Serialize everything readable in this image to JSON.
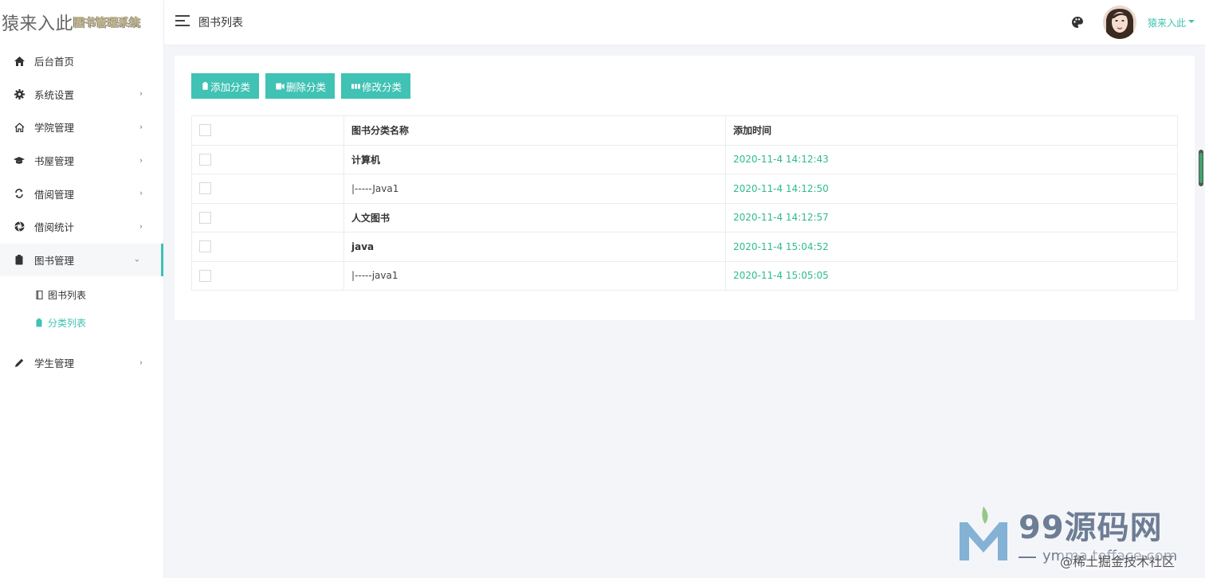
{
  "app": {
    "logo_main": "猿来入此",
    "logo_sub": "图书管理系统"
  },
  "header": {
    "title": "图书列表",
    "user_name": "猿来入此"
  },
  "sidebar": {
    "items": [
      {
        "label": "后台首页",
        "icon": "home-icon",
        "has_arrow": false
      },
      {
        "label": "系统设置",
        "icon": "gear-icon",
        "has_arrow": true
      },
      {
        "label": "学院管理",
        "icon": "house-outline-icon",
        "has_arrow": true
      },
      {
        "label": "书屋管理",
        "icon": "graduation-cap-icon",
        "has_arrow": true
      },
      {
        "label": "借阅管理",
        "icon": "refresh-icon",
        "has_arrow": true
      },
      {
        "label": "借阅统计",
        "icon": "aperture-icon",
        "has_arrow": true
      },
      {
        "label": "图书管理",
        "icon": "clipboard-icon",
        "has_arrow": true,
        "open": true
      },
      {
        "label": "学生管理",
        "icon": "pencil-icon",
        "has_arrow": true
      }
    ],
    "book_sub": [
      {
        "label": "图书列表",
        "icon": "book-icon",
        "active": false
      },
      {
        "label": "分类列表",
        "icon": "clipboard-icon",
        "active": true
      }
    ]
  },
  "toolbar": {
    "add_label": "添加分类",
    "delete_label": "删除分类",
    "edit_label": "修改分类"
  },
  "table": {
    "headers": [
      "",
      "图书分类名称",
      "添加时间"
    ],
    "rows": [
      {
        "name": "计算机",
        "level": "parent",
        "time": "2020-11-4 14:12:43"
      },
      {
        "name": "|-----Java1",
        "level": "child",
        "time": "2020-11-4 14:12:50"
      },
      {
        "name": "人文图书",
        "level": "parent",
        "time": "2020-11-4 14:12:57"
      },
      {
        "name": "java",
        "level": "parent",
        "time": "2020-11-4 15:04:52"
      },
      {
        "name": "|-----java1",
        "level": "child",
        "time": "2020-11-4 15:05:05"
      }
    ]
  },
  "watermark": {
    "brand": "99源码网",
    "url": "ymma.tofface.com",
    "sub": "@稀土掘金技术社区"
  },
  "colors": {
    "accent": "#40c2b4",
    "time_text": "#2ebd88",
    "background": "#f4f5f9"
  }
}
